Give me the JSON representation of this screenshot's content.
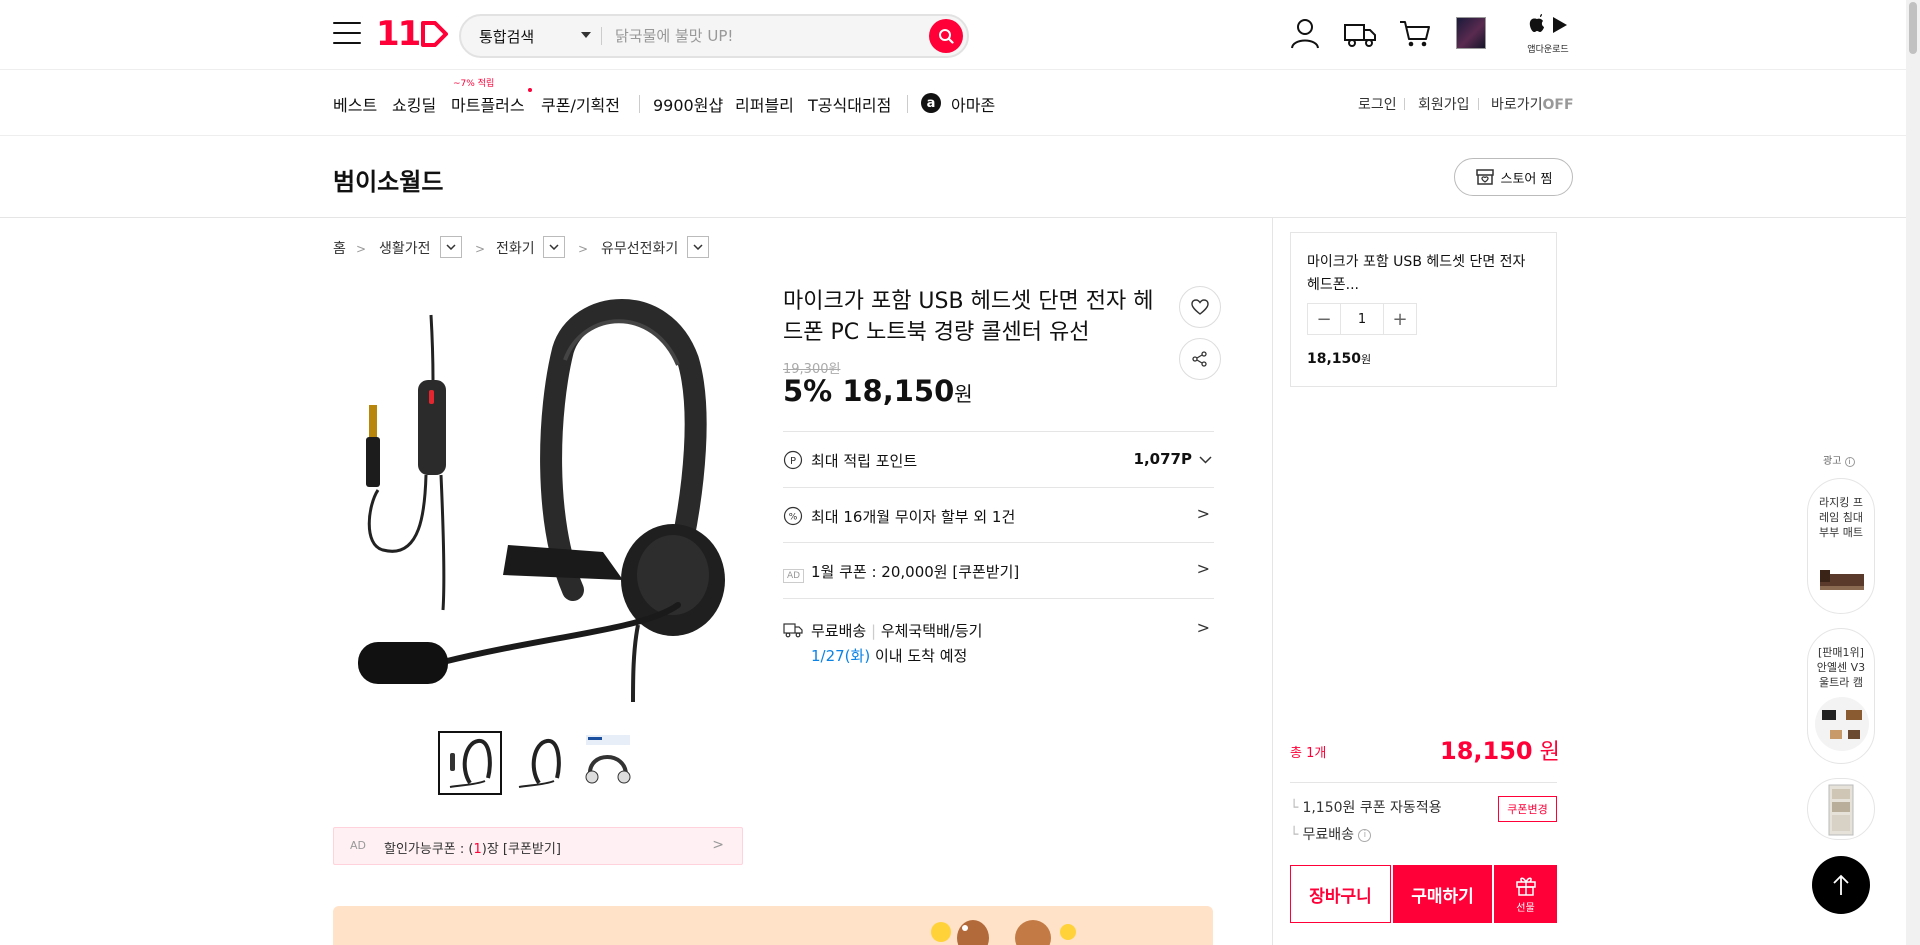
{
  "header": {
    "logo": "11",
    "search_scope": "통합검색",
    "search_placeholder": "닭국물에 불맛 UP!",
    "app_download_label": "앱다운로드"
  },
  "gnb": {
    "items": [
      "베스트",
      "쇼킹딜",
      "마트플러스",
      "쿠폰/기획전",
      "9900원샵",
      "리퍼블리",
      "T공식대리점",
      "아마존"
    ],
    "mart_badge": "~7% 적립",
    "util": {
      "login": "로그인",
      "join": "회원가입",
      "quick_prefix": "바로가기",
      "quick_state": "OFF"
    }
  },
  "store": {
    "name": "범이소월드",
    "zzim_label": "스토어 찜"
  },
  "breadcrumb": {
    "home": "홈",
    "cat1": "생활가전",
    "cat2": "전화기",
    "cat3": "유무선전화기"
  },
  "product": {
    "title": "마이크가 포함 USB 헤드셋 단면 전자 헤드폰 PC 노트북 경량 콜센터 유선",
    "original_price": "19,300원",
    "discount": "5%",
    "price": "18,150",
    "won": "원",
    "points_label": "최대 적립 포인트",
    "points_value": "1,077P",
    "installment": "최대 16개월 무이자 할부 외 1건",
    "coupon_ad_tag": "AD",
    "coupon_text": "1월 쿠폰 : 20,000원 [쿠폰받기]",
    "shipping_free": "무료배송",
    "shipping_method": "우체국택배/등기",
    "arrival_date": "1/27(화)",
    "arrival_suffix": " 이내 도착 예정"
  },
  "coupon_bar": {
    "ad": "AD",
    "prefix": "할인가능쿠폰 : (",
    "count": "1",
    "suffix": ")장 [쿠폰받기]"
  },
  "order": {
    "mini_title": "마이크가 포함 USB 헤드셋 단면 전자 헤드폰...",
    "qty": "1",
    "mini_price": "18,150",
    "mini_won": "원",
    "total_label": "총 1개",
    "total_value": "18,150",
    "total_won": " 원",
    "coupon_auto": "1,150원 쿠폰 자동적용",
    "coupon_change": "쿠폰변경",
    "free_shipping": "무료배송",
    "cart": "장바구니",
    "buy": "구매하기",
    "gift": "선물"
  },
  "ad_wing": {
    "label": "광고",
    "item1": "라지킹 프레임 침대 부부 매트",
    "item2": "[판매1위] 안옐센 V3 울트라 캠"
  },
  "colors": {
    "brand": "#ff0038",
    "link_blue": "#0b83e6"
  }
}
